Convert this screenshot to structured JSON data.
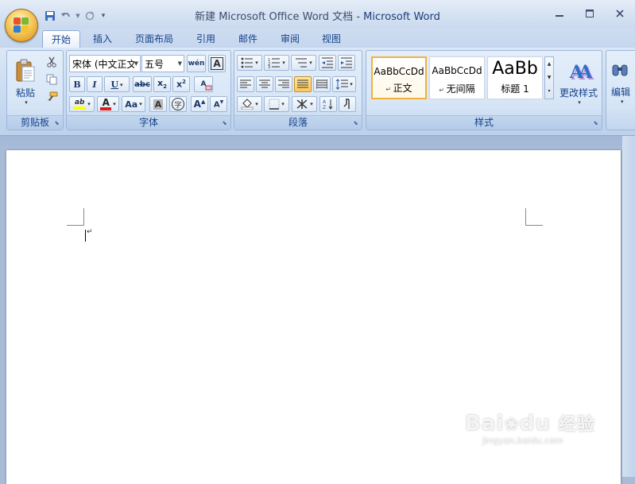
{
  "window": {
    "title_doc": "新建 Microsoft Office Word 文档",
    "title_sep": " - ",
    "title_app": "Microsoft Word"
  },
  "tabs": [
    {
      "label": "开始",
      "active": true
    },
    {
      "label": "插入"
    },
    {
      "label": "页面布局"
    },
    {
      "label": "引用"
    },
    {
      "label": "邮件"
    },
    {
      "label": "审阅"
    },
    {
      "label": "视图"
    }
  ],
  "groups": {
    "clipboard": {
      "title": "剪贴板",
      "paste_label": "粘贴",
      "icons": [
        "paste-icon",
        "cut-icon",
        "copy-icon",
        "format-painter-icon"
      ]
    },
    "font": {
      "title": "字体",
      "font_name": "宋体 (中文正文",
      "font_size": "五号",
      "bold": "B",
      "italic": "I",
      "underline": "U",
      "strike": "abc",
      "subscript_base": "x",
      "subscript_mark": "2",
      "superscript_base": "x",
      "superscript_mark": "2",
      "change_case": "Aa",
      "grow": "A",
      "shrink": "A",
      "highlight_sample": "ab",
      "font_color_sample": "A",
      "char_shading_sample": "A",
      "enclose_char": "字",
      "char_border_sample": "A",
      "phonetic_guide": "wén",
      "clear_format_sample": "A",
      "highlight_color": "#ffff00",
      "font_color": "#e01c1c"
    },
    "paragraph": {
      "title": "段落"
    },
    "styles": {
      "title": "样式",
      "cards": [
        {
          "preview": "AaBbCcDd",
          "name": "正文",
          "selected": true
        },
        {
          "preview": "AaBbCcDd",
          "name": "无间隔"
        },
        {
          "preview": "AaBb",
          "name": "标题 1"
        }
      ],
      "change_styles": "更改样式",
      "change_styles_icon": "AA"
    },
    "editing": {
      "label": "编辑"
    }
  },
  "document": {
    "paragraph_mark": "↵"
  },
  "watermark": {
    "big": "Bai",
    "big2": "du",
    "cn": "经验",
    "small": "jingyan.baidu.com"
  },
  "colors": {
    "accent": "#15428b",
    "selected_style_border": "#f0b13f",
    "ribbon_bg": "#c6d8ef"
  }
}
